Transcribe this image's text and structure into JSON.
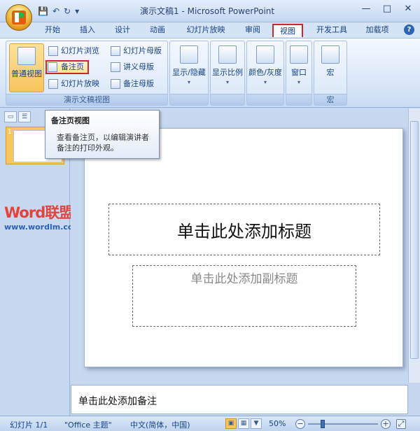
{
  "window": {
    "title": "演示文稿1 - Microsoft PowerPoint",
    "qat": {
      "save": "💾",
      "undo": "↶",
      "redo": "↻",
      "customize": "▾"
    },
    "minimize": "—",
    "maximize": "□",
    "close": "✕"
  },
  "tabs": [
    {
      "label": "开始"
    },
    {
      "label": "插入"
    },
    {
      "label": "设计"
    },
    {
      "label": "动画"
    },
    {
      "label": "幻灯片放映"
    },
    {
      "label": "审阅"
    },
    {
      "label": "视图"
    },
    {
      "label": "开发工具"
    },
    {
      "label": "加载项"
    }
  ],
  "active_tab": "视图",
  "help": "?",
  "ribbon": {
    "group_views": {
      "label": "演示文稿视图",
      "normal": "普通视图",
      "slide_sorter": "幻灯片浏览",
      "notes_page": "备注页",
      "slide_show": "幻灯片放映",
      "slide_master": "幻灯片母版",
      "handout_master": "讲义母版",
      "notes_master": "备注母版"
    },
    "show_hide": "显示/隐藏",
    "zoom": "显示比例",
    "color_gray": "颜色/灰度",
    "window": "窗口",
    "macros_btn": "宏",
    "macros_group": "宏"
  },
  "tooltip": {
    "title": "备注页视图",
    "line1": "查看备注页，以编辑演讲者",
    "line2": "备注的打印外观。"
  },
  "left_panel": {
    "slide_number": "1"
  },
  "watermark": {
    "title": "Word联盟",
    "url": "www.wordlm.com"
  },
  "slide": {
    "title_placeholder": "单击此处添加标题",
    "subtitle_placeholder": "单击此处添加副标题"
  },
  "notes": {
    "placeholder": "单击此处添加备注"
  },
  "status": {
    "slide_info": "幻灯片 1/1",
    "theme": "\"Office 主题\"",
    "language": "中文(简体，中国)",
    "zoom": "50%"
  }
}
